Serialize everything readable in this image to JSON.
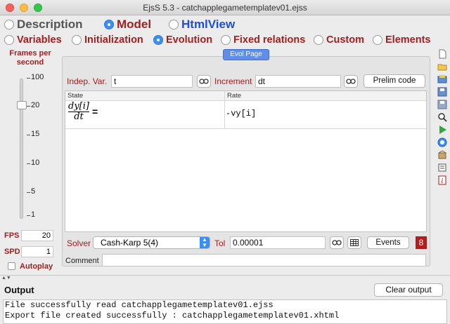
{
  "window": {
    "title": "EjsS 5.3 - catchapplegametemplatev01.ejss"
  },
  "main_tabs": [
    {
      "label": "Description",
      "selected": false
    },
    {
      "label": "Model",
      "selected": true
    },
    {
      "label": "HtmlView",
      "selected": false
    }
  ],
  "sub_tabs": [
    {
      "label": "Variables",
      "selected": false
    },
    {
      "label": "Initialization",
      "selected": false
    },
    {
      "label": "Evolution",
      "selected": true
    },
    {
      "label": "Fixed relations",
      "selected": false
    },
    {
      "label": "Custom",
      "selected": false
    },
    {
      "label": "Elements",
      "selected": false
    }
  ],
  "frames": {
    "label": "Frames per second",
    "ticks": [
      "100",
      "20",
      "15",
      "10",
      "5",
      "1"
    ],
    "fps_label": "FPS",
    "fps_value": "20",
    "spd_label": "SPD",
    "spd_value": "1",
    "autoplay_label": "Autoplay",
    "autoplay_checked": false
  },
  "evolution": {
    "page_tab": "Evol Page",
    "indep_var_label": "Indep. Var.",
    "indep_var_value": "t",
    "increment_label": "Increment",
    "increment_value": "dt",
    "prelim_button": "Prelim code",
    "table_headers": {
      "state": "State",
      "rate": "Rate"
    },
    "equation": {
      "numerator": "dy[i]",
      "denominator": "dt",
      "equals": "=",
      "rate": "-vy[i]"
    },
    "solver_label": "Solver",
    "solver_value": "Cash-Karp 5(4)",
    "tol_label": "Tol",
    "tol_value": "0.00001",
    "events_button": "Events",
    "events_count": "8",
    "comment_label": "Comment",
    "comment_value": ""
  },
  "output": {
    "title": "Output",
    "clear_button": "Clear output",
    "lines": [
      "File successfully read catchapplegametemplatev01.ejss",
      "Export file created successfully : catchapplegametemplatev01.xhtml"
    ]
  },
  "colors": {
    "accent_red": "#a02020",
    "accent_blue": "#1f4fd8",
    "radio_selected": "#3a8ff6"
  }
}
